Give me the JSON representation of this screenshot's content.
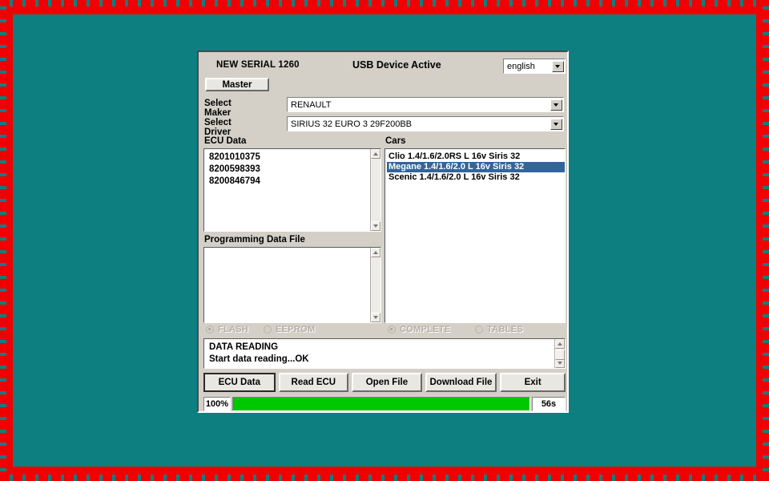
{
  "window": {
    "serial_label": "NEW SERIAL 1260",
    "usb_status": "USB Device Active",
    "language": {
      "value": "english",
      "icon": "chevron-down-icon"
    },
    "master_button_label": "Master"
  },
  "form": {
    "maker": {
      "label": "Select Maker",
      "value": "RENAULT",
      "icon": "chevron-down-icon"
    },
    "driver": {
      "label": "Select Driver",
      "value": "SIRIUS 32 EURO 3 29F200BB",
      "icon": "chevron-down-icon"
    }
  },
  "ecu_data": {
    "caption": "ECU Data",
    "items": [
      "8201010375",
      "8200598393",
      "8200846794"
    ]
  },
  "programming_data_file": {
    "caption": "Programming Data File",
    "items": []
  },
  "cars": {
    "caption": "Cars",
    "items": [
      {
        "label": "Clio 1.4/1.6/2.0RS L 16v Siris 32",
        "selected": false
      },
      {
        "label": "Megane 1.4/1.6/2.0 L 16v Siris 32",
        "selected": true
      },
      {
        "label": "Scenic 1.4/1.6/2.0 L 16v Siris 32",
        "selected": false
      }
    ],
    "selection_color": "#31659c"
  },
  "modes": {
    "memory": [
      {
        "label": "FLASH",
        "checked": true,
        "disabled": true
      },
      {
        "label": "EEPROM",
        "checked": false,
        "disabled": true
      }
    ],
    "scope": [
      {
        "label": "COMPLETE",
        "checked": true,
        "disabled": true
      },
      {
        "label": "TABLES",
        "checked": false,
        "disabled": true
      }
    ]
  },
  "messages": {
    "lines": [
      "DATA READING",
      "Start data reading...OK"
    ]
  },
  "actions": [
    {
      "label": "ECU Data",
      "focused": true
    },
    {
      "label": "Read ECU",
      "focused": false
    },
    {
      "label": "Open File",
      "focused": false
    },
    {
      "label": "Download File",
      "focused": false
    },
    {
      "label": "Exit",
      "focused": false
    }
  ],
  "progress": {
    "percent_label": "100%",
    "percent_value": 100,
    "elapsed_label": "56s",
    "fill_color": "#00c800"
  },
  "desktop": {
    "background_color": "#0d7f80",
    "border_color": "#f00000"
  }
}
